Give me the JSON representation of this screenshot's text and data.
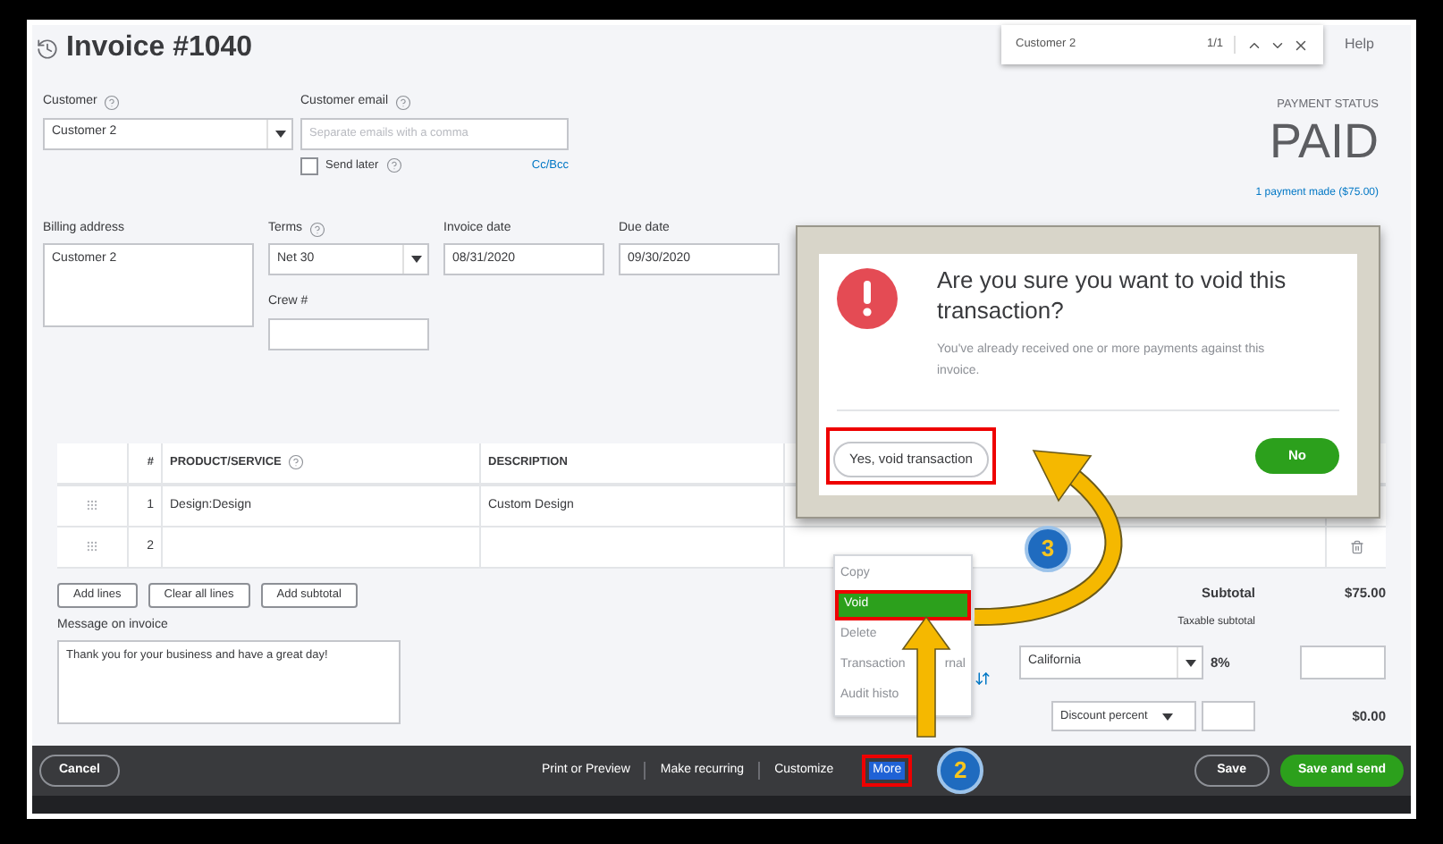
{
  "header": {
    "title": "Invoice #1040"
  },
  "find_bar": {
    "query": "Customer 2",
    "count": "1/1",
    "help": "Help"
  },
  "customer": {
    "label": "Customer",
    "value": "Customer 2"
  },
  "customer_email": {
    "label": "Customer email",
    "placeholder": "Separate emails with a comma",
    "send_later": {
      "label": "Send later",
      "checked": false
    },
    "cc_bcc": "Cc/Bcc"
  },
  "payment_status": {
    "label": "PAYMENT STATUS",
    "value": "PAID",
    "link": "1 payment made ($75.00)"
  },
  "billing_address": {
    "label": "Billing address",
    "value": "Customer 2"
  },
  "terms": {
    "label": "Terms",
    "value": "Net 30"
  },
  "invoice_date": {
    "label": "Invoice date",
    "value": "08/31/2020"
  },
  "due_date": {
    "label": "Due date",
    "value": "09/30/2020"
  },
  "crew": {
    "label": "Crew #"
  },
  "table": {
    "columns": [
      "#",
      "PRODUCT/SERVICE",
      "DESCRIPTION"
    ],
    "rows": [
      {
        "number": "1",
        "product": "Design:Design",
        "description": "Custom Design"
      },
      {
        "number": "2"
      }
    ]
  },
  "line_buttons": [
    "Add lines",
    "Clear all lines",
    "Add subtotal"
  ],
  "message": {
    "label": "Message on invoice",
    "value": "Thank you for your business and have a great day!"
  },
  "totals": {
    "subtotal_label": "Subtotal",
    "subtotal": "$75.00",
    "taxable_label": "Taxable subtotal",
    "tax_region": "California",
    "tax_rate": "8%",
    "discount": "Discount percent",
    "total": "$0.00"
  },
  "more_menu": [
    {
      "label": "Copy",
      "selected": false
    },
    {
      "label": "Void",
      "selected": true
    },
    {
      "label": "Delete",
      "selected": false
    },
    {
      "label": "Transaction",
      "tail": "rnal",
      "selected": false
    },
    {
      "label": "Audit histo",
      "selected": false
    }
  ],
  "footer": {
    "cancel": "Cancel",
    "actions": [
      "Print or Preview",
      "Make recurring",
      "Customize"
    ],
    "more": "More",
    "save": "Save",
    "save_and_send": "Save and send"
  },
  "dialog": {
    "title": "Are you sure you want to void this transaction?",
    "body": "You've already received one or more payments against this invoice.",
    "confirm": "Yes, void transaction",
    "cancel": "No"
  },
  "steps": [
    "2",
    "3"
  ]
}
